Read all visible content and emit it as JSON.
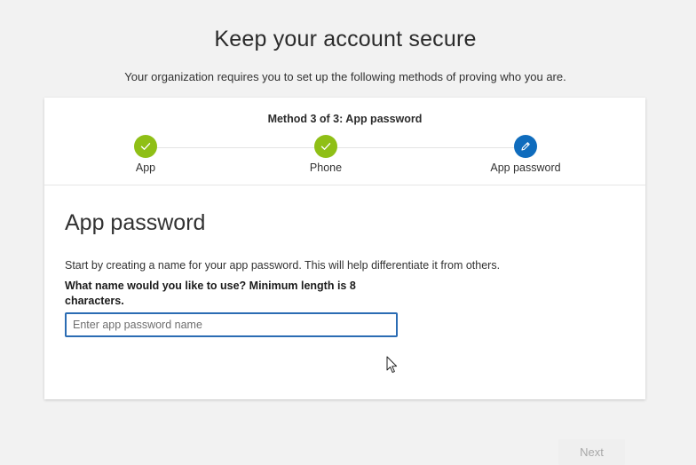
{
  "header": {
    "title": "Keep your account secure",
    "subtitle": "Your organization requires you to set up the following methods of proving who you are."
  },
  "stepper": {
    "method_label": "Method 3 of 3: App password",
    "steps": [
      {
        "label": "App",
        "status": "complete",
        "icon": "checkmark-icon"
      },
      {
        "label": "Phone",
        "status": "complete",
        "icon": "checkmark-icon"
      },
      {
        "label": "App password",
        "status": "current",
        "icon": "pencil-icon"
      }
    ]
  },
  "form": {
    "section_title": "App password",
    "description": "Start by creating a name for your app password. This will help differentiate it from others.",
    "question": "What name would you like to use? Minimum length is 8 characters.",
    "input": {
      "value": "",
      "placeholder": "Enter app password name"
    },
    "next_label": "Next"
  },
  "colors": {
    "complete": "#8fbf16",
    "current": "#0f6cbd",
    "input_border": "#2b6cb3",
    "disabled_button_bg": "#efefef",
    "disabled_button_text": "#a8a8a8"
  }
}
